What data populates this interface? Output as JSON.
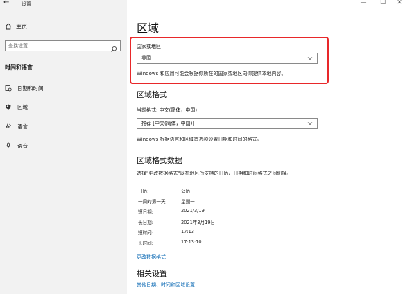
{
  "window": {
    "title": "设置",
    "controls": {
      "minimize": "—",
      "maximize": "☐",
      "close": "✕"
    }
  },
  "sidebar": {
    "back_glyph": "←",
    "home_label": "主页",
    "search_placeholder": "查找设置",
    "section_title": "时间和语言",
    "items": [
      {
        "label": "日期和时间",
        "icon": "calendar-clock-icon"
      },
      {
        "label": "区域",
        "icon": "globe-icon"
      },
      {
        "label": "语言",
        "icon": "language-icon"
      },
      {
        "label": "语音",
        "icon": "microphone-icon"
      }
    ]
  },
  "main": {
    "title": "区域",
    "country": {
      "label": "国家或地区",
      "value": "美国",
      "note": "Windows 和应用可能会根据你所在的国家或地区向你提供本地内容。"
    },
    "format": {
      "heading": "区域格式",
      "current": "当前格式: 中文(简体，中国)",
      "value": "推荐 [中文(简体，中国)]",
      "note": "Windows 根据语言和区域首选项设置日期和时间的格式。"
    },
    "format_data": {
      "heading": "区域格式数据",
      "note": "选择\"更改数据格式\"以在地区所支持的日历、日期和时间格式之间切换。",
      "rows": [
        {
          "key": "日历:",
          "value": "公历"
        },
        {
          "key": "一周的第一天:",
          "value": "星期一"
        },
        {
          "key": "短日期:",
          "value": "2021/3/19"
        },
        {
          "key": "长日期:",
          "value": "2021年3月19日"
        },
        {
          "key": "短时间:",
          "value": "17:13"
        },
        {
          "key": "长时间:",
          "value": "17:13:10"
        }
      ],
      "change_link": "更改数据格式"
    },
    "related": {
      "heading": "相关设置",
      "link": "其他日期、时间和区域设置"
    }
  },
  "colors": {
    "sidebar_bg": "#f2f2f2",
    "highlight_border": "#e8282a",
    "link": "#0063b1"
  }
}
